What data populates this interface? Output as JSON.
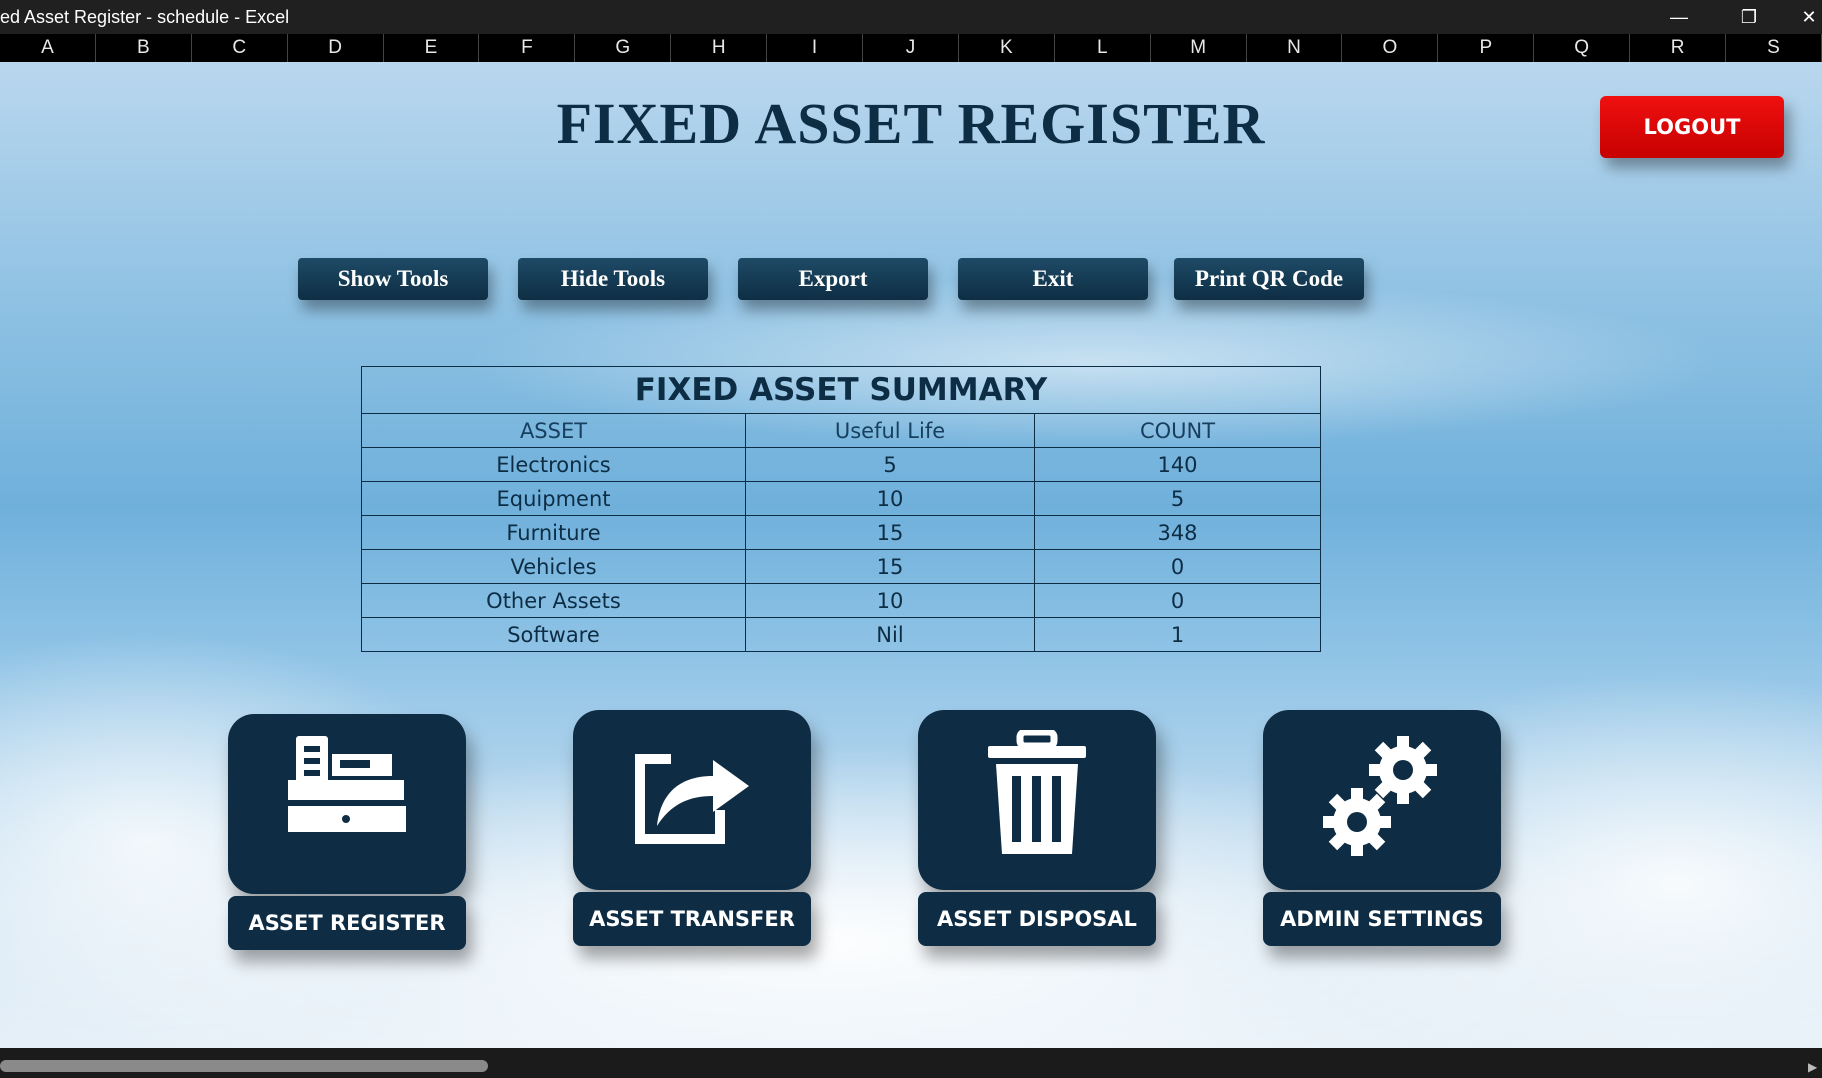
{
  "window": {
    "title": "ed Asset Register - schedule - Excel",
    "minimize": "—",
    "restore": "❐",
    "close": "✕"
  },
  "columns": [
    "A",
    "B",
    "C",
    "D",
    "E",
    "F",
    "G",
    "H",
    "I",
    "J",
    "K",
    "L",
    "M",
    "N",
    "O",
    "P",
    "Q",
    "R",
    "S"
  ],
  "dashboard": {
    "title": "FIXED ASSET REGISTER",
    "logout": "LOGOUT",
    "tools": {
      "show": "Show Tools",
      "hide": "Hide Tools",
      "export": "Export",
      "exit": "Exit",
      "print_qr": "Print QR Code"
    },
    "summary": {
      "title": "FIXED ASSET SUMMARY",
      "headers": [
        "ASSET",
        "Useful Life",
        "COUNT"
      ],
      "rows": [
        [
          "Electronics",
          "5",
          "140"
        ],
        [
          "Equipment",
          "10",
          "5"
        ],
        [
          "Furniture",
          "15",
          "348"
        ],
        [
          "Vehicles",
          "15",
          "0"
        ],
        [
          "Other Assets",
          "10",
          "0"
        ],
        [
          "Software",
          "Nil",
          "1"
        ]
      ]
    },
    "tiles": {
      "register": "ASSET REGISTER",
      "transfer": "ASSET TRANSFER",
      "disposal": "ASSET DISPOSAL",
      "admin": "ADMIN SETTINGS"
    }
  },
  "icons": [
    "cash-register-icon",
    "share-export-icon",
    "trash-icon",
    "gears-icon"
  ]
}
